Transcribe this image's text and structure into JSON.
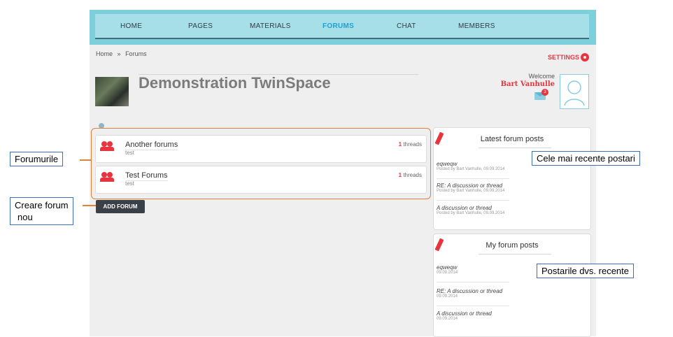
{
  "nav": {
    "items": [
      {
        "label": "HOME",
        "active": false
      },
      {
        "label": "PAGES",
        "active": false
      },
      {
        "label": "MATERIALS",
        "active": false
      },
      {
        "label": "FORUMS",
        "active": true
      },
      {
        "label": "CHAT",
        "active": false
      },
      {
        "label": "MEMBERS",
        "active": false
      }
    ]
  },
  "breadcrumb": {
    "home": "Home",
    "sep": "»",
    "current": "Forums"
  },
  "settings_label": "SETTINGS",
  "page_title": "Demonstration TwinSpace",
  "user": {
    "welcome": "Welcome",
    "name": "Bart Vanhulle",
    "mail_count": "3"
  },
  "forums": [
    {
      "name": "Another forums",
      "desc": "test",
      "threads_count": "1",
      "threads_label": "threads"
    },
    {
      "name": "Test Forums",
      "desc": "test",
      "threads_count": "1",
      "threads_label": "threads"
    }
  ],
  "add_forum_label": "ADD FORUM",
  "latest_posts": {
    "title": "Latest forum posts",
    "posts": [
      {
        "title": "eqweqw",
        "meta": "Posted by Bart Vanhulle, 09.09.2014"
      },
      {
        "title": "RE: A discussion or thread",
        "meta": "Posted by Bart Vanhulle, 09.09.2014"
      },
      {
        "title": "A discussion or thread",
        "meta": "Posted by Bart Vanhulle, 09.09.2014"
      }
    ]
  },
  "my_posts": {
    "title": "My forum posts",
    "posts": [
      {
        "title": "eqweqw",
        "meta": "09.09.2014"
      },
      {
        "title": "RE: A discussion or thread",
        "meta": "09.09.2014"
      },
      {
        "title": "A discussion or thread",
        "meta": "09.09.2014"
      }
    ]
  },
  "callouts": {
    "forums": "Forumurile",
    "create_line1": "Creare forum",
    "create_line2": "nou",
    "latest": "Cele mai recente postari",
    "mine": "Postarile dvs. recente"
  },
  "colors": {
    "accent": "#e8343f",
    "nav_active": "#1ea0d3",
    "nav_bg": "#7ecfdc",
    "callout_border": "#3b6fb6",
    "highlight": "#e0813c"
  }
}
